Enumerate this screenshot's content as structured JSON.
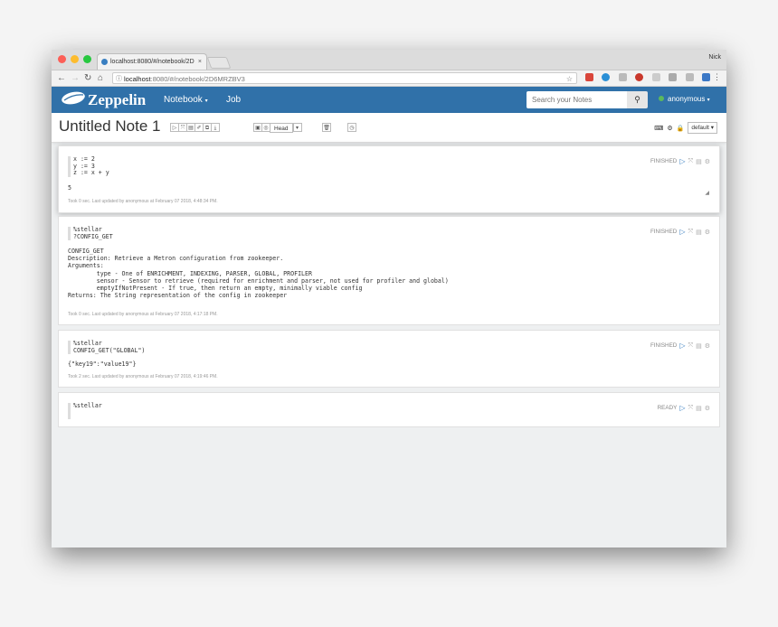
{
  "browser": {
    "tab_title": "localhost:8080/#/notebook/2D",
    "tab_close": "×",
    "profile": "Nick",
    "url_host": "localhost",
    "url_rest": ":8080/#/notebook/2D6MRZBV3"
  },
  "navbar": {
    "brand": "Zeppelin",
    "notebook": "Notebook",
    "job": "Job",
    "search_placeholder": "Search your Notes",
    "user": "anonymous"
  },
  "note": {
    "title": "Untitled Note 1",
    "head_label": "Head",
    "default_label": "default"
  },
  "colors": {
    "navbar": "#3071a9",
    "play": "#3a7fc1",
    "status_dot": "#5cb85c"
  },
  "paragraphs": [
    {
      "code": "x := 2\ny := 3\nz := x + y",
      "output": "5",
      "footer": "Took 0 sec. Last updated by anonymous at February 07 2018, 4:48:34 PM.",
      "status": "FINISHED"
    },
    {
      "code": "%stellar\n?CONFIG_GET",
      "output": "CONFIG_GET\nDescription: Retrieve a Metron configuration from zookeeper.\nArguments:\n        type - One of ENRICHMENT, INDEXING, PARSER, GLOBAL, PROFILER\n        sensor - Sensor to retrieve (required for enrichment and parser, not used for profiler and global)\n        emptyIfNotPresent - If true, then return an empty, minimally viable config\nReturns: The String representation of the config in zookeeper",
      "footer": "Took 0 sec. Last updated by anonymous at February 07 2018, 4:17:18 PM.",
      "status": "FINISHED"
    },
    {
      "code": "%stellar\nCONFIG_GET(\"GLOBAL\")",
      "output": "{\"key19\":\"value19\"}",
      "footer": "Took 2 sec. Last updated by anonymous at February 07 2018, 4:19:46 PM.",
      "status": "FINISHED"
    },
    {
      "code": "%stellar",
      "status": "READY"
    }
  ]
}
